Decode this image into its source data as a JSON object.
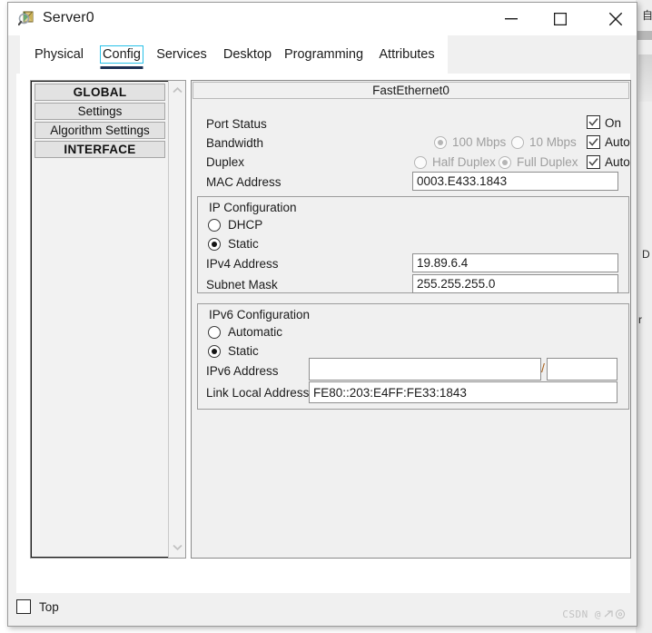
{
  "window": {
    "title": "Server0",
    "icon": "server-inspect-icon",
    "controls": {
      "minimize": "minimize-icon",
      "maximize": "maximize-icon",
      "close": "close-icon"
    }
  },
  "tabs": {
    "active": "Config",
    "items": [
      {
        "label": "Physical"
      },
      {
        "label": "Config"
      },
      {
        "label": "Services"
      },
      {
        "label": "Desktop"
      },
      {
        "label": "Programming"
      },
      {
        "label": "Attributes"
      }
    ]
  },
  "sidebar": {
    "items": [
      {
        "label": "GLOBAL",
        "type": "group"
      },
      {
        "label": "Settings",
        "type": "item"
      },
      {
        "label": "Algorithm Settings",
        "type": "item"
      },
      {
        "label": "INTERFACE",
        "type": "group"
      }
    ],
    "scroll_up_icon": "chevron-up-icon",
    "scroll_down_icon": "chevron-down-icon"
  },
  "panel": {
    "header": "FastEthernet0",
    "port_status": {
      "label": "Port Status",
      "checkbox_label": "On",
      "checked": true
    },
    "bandwidth": {
      "label": "Bandwidth",
      "options": [
        {
          "label": "100 Mbps",
          "selected": true,
          "disabled": true
        },
        {
          "label": "10 Mbps",
          "selected": false,
          "disabled": true
        }
      ],
      "auto_label": "Auto",
      "auto_checked": true
    },
    "duplex": {
      "label": "Duplex",
      "options": [
        {
          "label": "Half Duplex",
          "selected": false,
          "disabled": true
        },
        {
          "label": "Full Duplex",
          "selected": true,
          "disabled": true
        }
      ],
      "auto_label": "Auto",
      "auto_checked": true
    },
    "mac_address": {
      "label": "MAC Address",
      "value": "0003.E433.1843"
    },
    "ip_config": {
      "legend": "IP Configuration",
      "radios": [
        {
          "label": "DHCP",
          "selected": false
        },
        {
          "label": "Static",
          "selected": true
        }
      ],
      "ipv4": {
        "label": "IPv4 Address",
        "value": "19.89.6.4",
        "placeholder": ""
      },
      "subnet": {
        "label": "Subnet Mask",
        "value": "255.255.255.0",
        "placeholder": ""
      }
    },
    "ipv6_config": {
      "legend": "IPv6 Configuration",
      "radios": [
        {
          "label": "Automatic",
          "selected": false
        },
        {
          "label": "Static",
          "selected": true
        }
      ],
      "ipv6": {
        "label": "IPv6 Address",
        "value": "",
        "placeholder": "",
        "separator": "/",
        "prefix_value": "",
        "prefix_placeholder": ""
      },
      "link_local": {
        "label": "Link Local Address:",
        "value": "FE80::203:E4FF:FE33:1843"
      }
    }
  },
  "bottom": {
    "top_checkbox": {
      "label": "Top",
      "checked": false
    }
  },
  "watermark": {
    "text": "CSDN @"
  },
  "colors": {
    "accent": "#27c1e8",
    "tab_underline": "#1b2f52",
    "window_bg": "#f0f0f0",
    "field_bg": "#ffffff",
    "disabled_text": "#9e9e9e"
  }
}
